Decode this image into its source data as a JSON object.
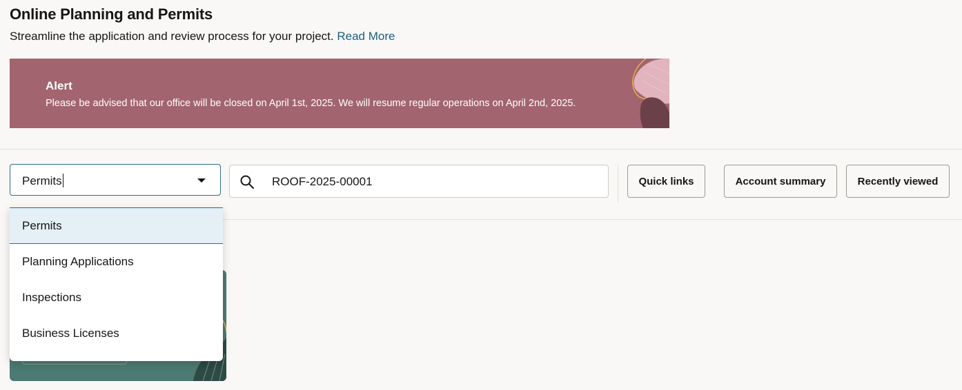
{
  "header": {
    "title": "Online Planning and Permits",
    "subtitle": "Streamline the application and review process for your project.",
    "read_more": "Read More"
  },
  "alert": {
    "title": "Alert",
    "message": "Please be advised that our office will be closed on April 1st, 2025. We will resume regular operations on April 2nd, 2025.",
    "background_color": "#a2646e"
  },
  "search_bar": {
    "category_value": "Permits",
    "search_icon": "search-icon",
    "search_value": "ROOF-2025-00001",
    "options": [
      "Permits",
      "Planning Applications",
      "Inspections",
      "Business Licenses"
    ],
    "highlighted_option": "Permits"
  },
  "buttons": {
    "quick_links": "Quick links",
    "account_summary": "Account summary",
    "recently_viewed": "Recently viewed"
  },
  "colors": {
    "accent": "#2f6b82",
    "link": "#1a6080",
    "card": "#4d7a72"
  }
}
